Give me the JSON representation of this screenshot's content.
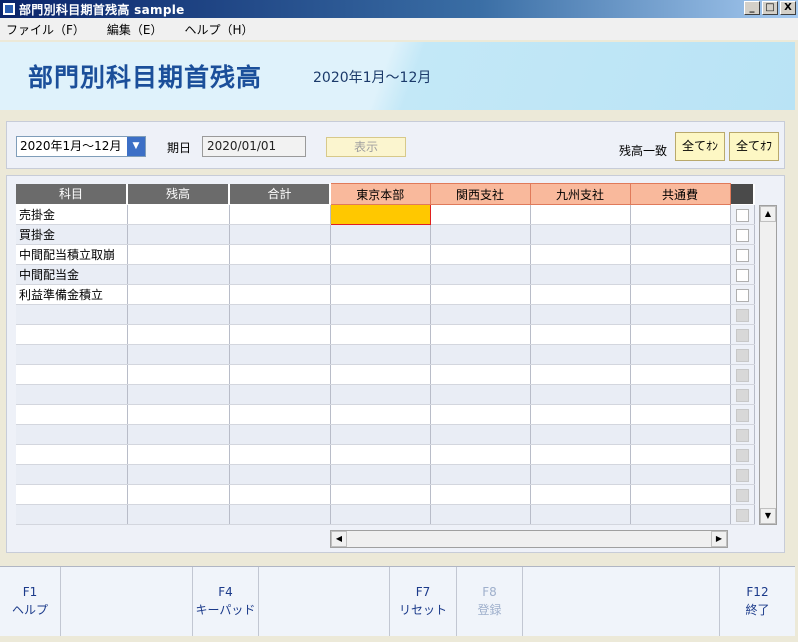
{
  "window": {
    "title": "部門別科目期首残高 sample",
    "buttons": [
      "_",
      "□",
      "X"
    ]
  },
  "menu": [
    {
      "label": "ファイル（F）"
    },
    {
      "label": "編集（E）"
    },
    {
      "label": "ヘルプ（H）"
    }
  ],
  "header": {
    "title": "部門別科目期首残高",
    "period": "2020年1月～12月"
  },
  "filter": {
    "period_select": "2020年1月～12月",
    "date_label": "期日",
    "date_value": "2020/01/01",
    "show_button": "表示",
    "match_label": "残高一致",
    "all_on_button": "全てｵﾝ",
    "all_off_button": "全てｵﾌ"
  },
  "grid": {
    "columns": [
      "科目",
      "残高",
      "合計",
      "東京本部",
      "関西支社",
      "九州支社",
      "共通費"
    ],
    "rows": [
      {
        "account": "売掛金",
        "checkbox": "enabled"
      },
      {
        "account": "買掛金",
        "checkbox": "enabled"
      },
      {
        "account": "中間配当積立取崩",
        "checkbox": "enabled"
      },
      {
        "account": "中間配当金",
        "checkbox": "enabled"
      },
      {
        "account": "利益準備金積立",
        "checkbox": "enabled"
      },
      {
        "account": "",
        "checkbox": "disabled"
      },
      {
        "account": "",
        "checkbox": "disabled"
      },
      {
        "account": "",
        "checkbox": "disabled"
      },
      {
        "account": "",
        "checkbox": "disabled"
      },
      {
        "account": "",
        "checkbox": "disabled"
      },
      {
        "account": "",
        "checkbox": "disabled"
      },
      {
        "account": "",
        "checkbox": "disabled"
      },
      {
        "account": "",
        "checkbox": "disabled"
      },
      {
        "account": "",
        "checkbox": "disabled"
      },
      {
        "account": "",
        "checkbox": "disabled"
      },
      {
        "account": "",
        "checkbox": "disabled"
      }
    ]
  },
  "fkeys": [
    {
      "key": "F1",
      "label": "ヘルプ",
      "enabled": true
    },
    {
      "key": "",
      "label": "",
      "enabled": true
    },
    {
      "key": "F4",
      "label": "キーパッド",
      "enabled": true
    },
    {
      "key": "",
      "label": "",
      "enabled": true
    },
    {
      "key": "F7",
      "label": "リセット",
      "enabled": true
    },
    {
      "key": "F8",
      "label": "登録",
      "enabled": false
    },
    {
      "key": "",
      "label": "",
      "enabled": true
    },
    {
      "key": "F12",
      "label": "終了",
      "enabled": true
    }
  ]
}
